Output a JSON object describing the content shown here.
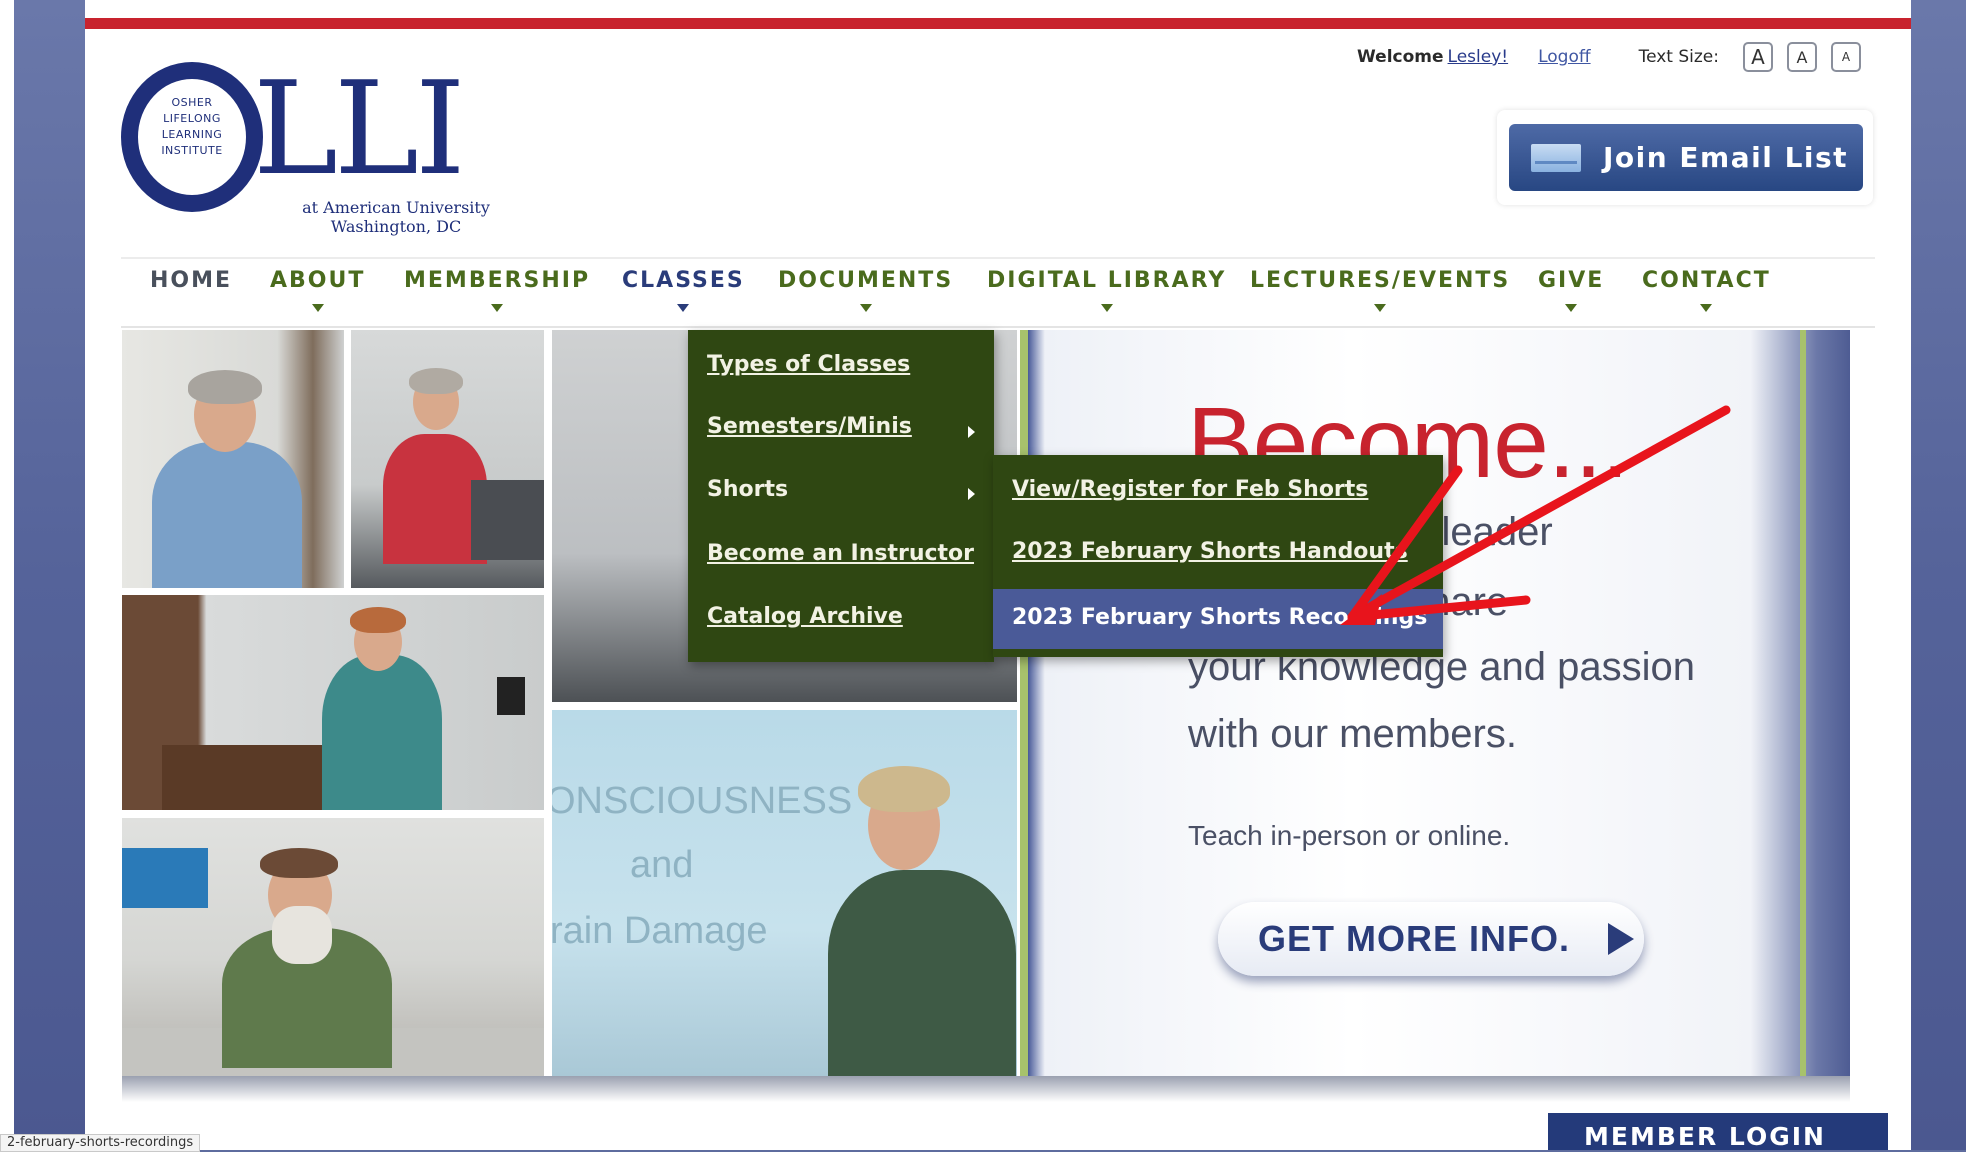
{
  "header": {
    "welcome_label": "Welcome",
    "user_name": "Lesley!",
    "logoff_label": "Logoff",
    "text_size_label": "Text Size:",
    "text_size_options": [
      "A",
      "A",
      "A"
    ],
    "join_email_label": "Join Email List"
  },
  "logo": {
    "ring_text": "OSHER LIFELONG LEARNING INSTITUTE",
    "main": "LLI",
    "subtitle_line1": "at American University",
    "subtitle_line2": "Washington, DC"
  },
  "nav": {
    "items": [
      {
        "label": "HOME"
      },
      {
        "label": "ABOUT"
      },
      {
        "label": "MEMBERSHIP"
      },
      {
        "label": "CLASSES"
      },
      {
        "label": "DOCUMENTS"
      },
      {
        "label": "DIGITAL LIBRARY"
      },
      {
        "label": "LECTURES/EVENTS"
      },
      {
        "label": "GIVE"
      },
      {
        "label": "CONTACT"
      }
    ]
  },
  "classes_menu": {
    "items": [
      {
        "label": "Types of Classes"
      },
      {
        "label": "Semesters/Minis"
      },
      {
        "label": "Shorts"
      },
      {
        "label": "Become an Instructor"
      },
      {
        "label": "Catalog Archive"
      }
    ]
  },
  "shorts_menu": {
    "items": [
      {
        "label": "View/Register for Feb Shorts"
      },
      {
        "label": "2023 February Shorts Handouts"
      },
      {
        "label": "2023 February Shorts Recordings"
      }
    ]
  },
  "hero": {
    "headline": "Become...",
    "line1": "a study group leader",
    "line2": "at OLLI and share",
    "line3": "your knowledge and passion",
    "line4": "with our members.",
    "teach": "Teach in-person or online.",
    "button_label": "GET MORE INFO.",
    "photo_caption_1": "ONSCIOUSNESS",
    "photo_caption_2": "and",
    "photo_caption_3": "rain Damage"
  },
  "status_bar_text": "2-february-shorts-recordings",
  "member_login_label": "MEMBER LOGIN",
  "colors": {
    "brand_navy": "#1f2f7a",
    "accent_red": "#c8232e",
    "menu_green": "#2f4712",
    "nav_green": "#4a6b1d",
    "highlight": "#4a5a98"
  }
}
